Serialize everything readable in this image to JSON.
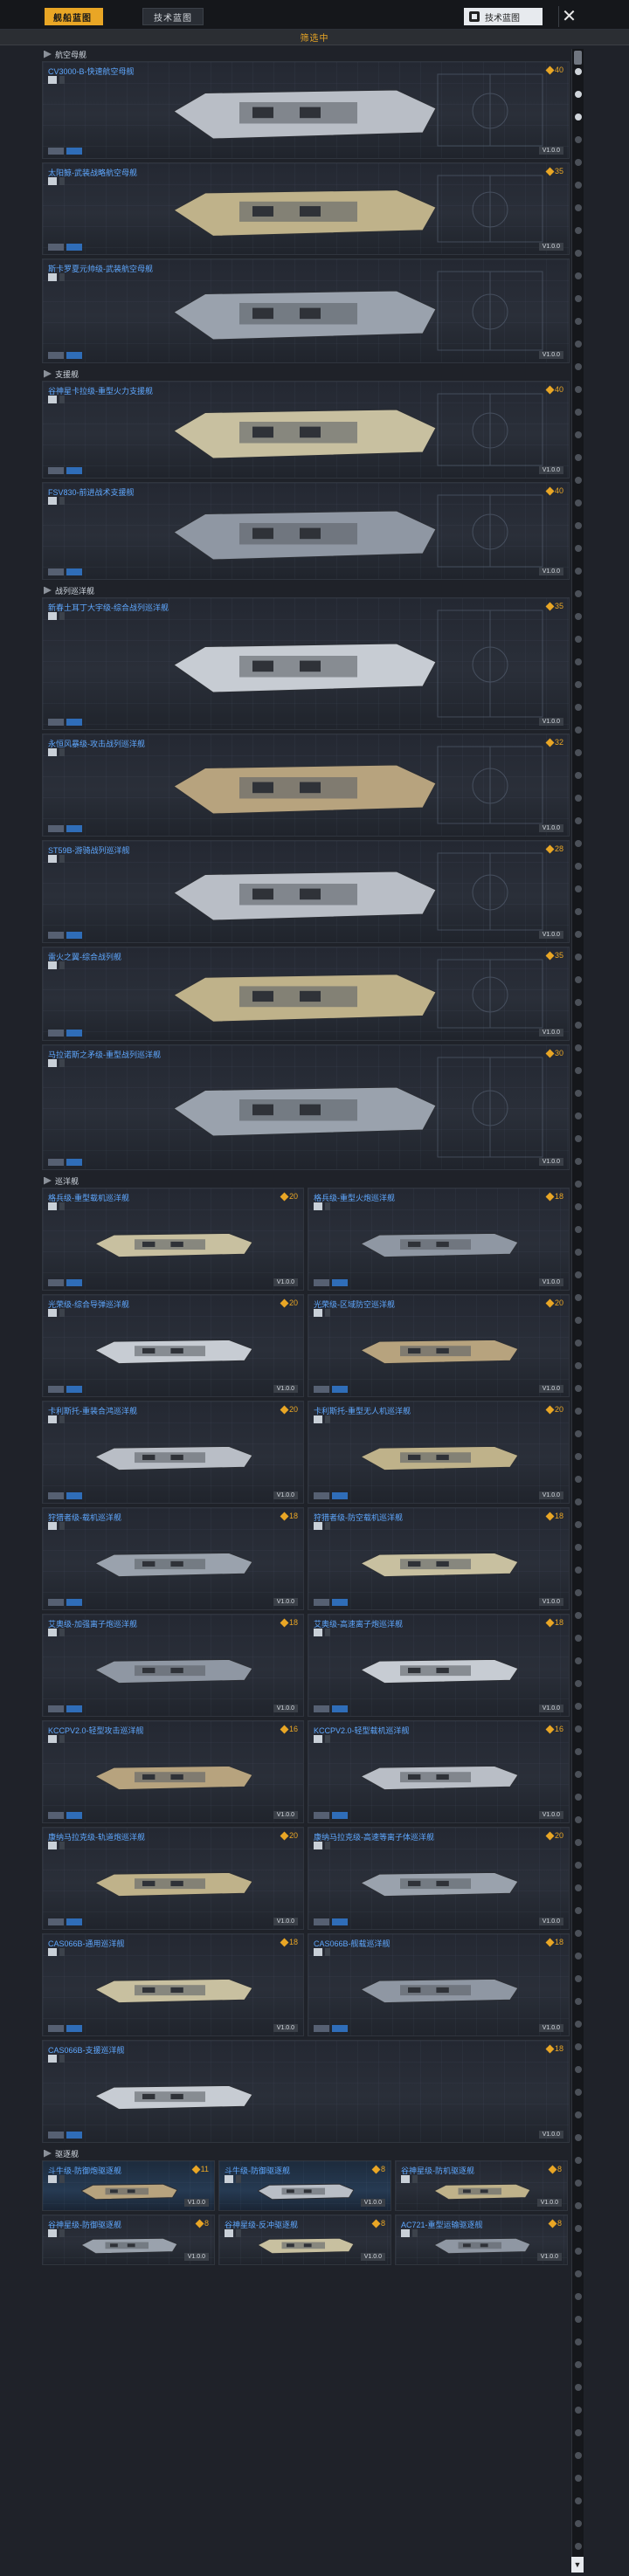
{
  "topbar": {
    "tab_active": "舰船蓝图",
    "tab_inactive": "技术蓝图",
    "tech_button": "技术蓝图",
    "close": "✕"
  },
  "statusbar": {
    "text": "筛选中"
  },
  "categories": {
    "carrier": "航空母舰",
    "support": "支援舰",
    "battlecruiser": "战列巡洋舰",
    "cruiser": "巡洋舰",
    "destroyer": "驱逐舰"
  },
  "ships": {
    "c1": {
      "name": "CV3000-B-快速航空母舰",
      "cost": "40",
      "ver": "V1.0.0"
    },
    "c2": {
      "name": "太阳鲸-武装战略航空母舰",
      "cost": "35",
      "ver": "V1.0.0"
    },
    "c3": {
      "name": "斯卡罗夏元帅级-武装航空母舰",
      "cost": "",
      "ver": "V1.0.0"
    },
    "s1": {
      "name": "谷神星卡拉级-重型火力支援舰",
      "cost": "40",
      "ver": "V1.0.0"
    },
    "s2": {
      "name": "FSV830-前进战术支援舰",
      "cost": "40",
      "ver": "V1.0.0"
    },
    "b1": {
      "name": "新春土耳丁大宇级-综合战列巡洋舰",
      "cost": "35",
      "ver": "V1.0.0"
    },
    "b2": {
      "name": "永恒风暴级-攻击战列巡洋舰",
      "cost": "32",
      "ver": "V1.0.0"
    },
    "b3": {
      "name": "ST59B-游骑战列巡洋舰",
      "cost": "28",
      "ver": "V1.0.0"
    },
    "b4": {
      "name": "雷火之翼-综合战列舰",
      "cost": "35",
      "ver": "V1.0.0"
    },
    "b5": {
      "name": "马拉诺斯之矛级-重型战列巡洋舰",
      "cost": "30",
      "ver": "V1.0.0"
    },
    "cr1": {
      "name": "格兵级-重型载机巡洋舰",
      "cost": "20",
      "ver": "V1.0.0"
    },
    "cr2": {
      "name": "格兵级-重型火炮巡洋舰",
      "cost": "18",
      "ver": "V1.0.0"
    },
    "cr3": {
      "name": "光荣级-综合导弹巡洋舰",
      "cost": "20",
      "ver": "V1.0.0"
    },
    "cr4": {
      "name": "光荣级-区域防空巡洋舰",
      "cost": "20",
      "ver": "V1.0.0"
    },
    "cr5": {
      "name": "卡利斯托-重装合鸿巡洋舰",
      "cost": "20",
      "ver": "V1.0.0"
    },
    "cr6": {
      "name": "卡利斯托-重型无人机巡洋舰",
      "cost": "20",
      "ver": "V1.0.0"
    },
    "cr7": {
      "name": "狩猎者级-载机巡洋舰",
      "cost": "18",
      "ver": "V1.0.0"
    },
    "cr8": {
      "name": "狩猎者级-防空载机巡洋舰",
      "cost": "18",
      "ver": "V1.0.0"
    },
    "cr9": {
      "name": "艾奥级-加强离子炮巡洋舰",
      "cost": "18",
      "ver": "V1.0.0"
    },
    "cr10": {
      "name": "艾奥级-高速离子炮巡洋舰",
      "cost": "18",
      "ver": "V1.0.0"
    },
    "cr11": {
      "name": "KCCPV2.0-轻型攻击巡洋舰",
      "cost": "16",
      "ver": "V1.0.0"
    },
    "cr12": {
      "name": "KCCPV2.0-轻型载机巡洋舰",
      "cost": "16",
      "ver": "V1.0.0"
    },
    "cr13": {
      "name": "康纳马拉克级-轨道炮巡洋舰",
      "cost": "20",
      "ver": "V1.0.0"
    },
    "cr14": {
      "name": "康纳马拉克级-高速等离子体巡洋舰",
      "cost": "20",
      "ver": "V1.0.0"
    },
    "cr15": {
      "name": "CAS066B-通用巡洋舰",
      "cost": "18",
      "ver": "V1.0.0"
    },
    "cr16": {
      "name": "CAS066B-舰载巡洋舰",
      "cost": "18",
      "ver": "V1.0.0"
    },
    "cr17": {
      "name": "CAS066B-支援巡洋舰",
      "cost": "18",
      "ver": "V1.0.0"
    },
    "d1": {
      "name": "斗牛级-防御炮驱逐舰",
      "cost": "11",
      "ver": "V1.0.0"
    },
    "d2": {
      "name": "斗牛级-防御驱逐舰",
      "cost": "8",
      "ver": "V1.0.0"
    },
    "d3": {
      "name": "谷神星级-防机驱逐舰",
      "cost": "8",
      "ver": "V1.0.0"
    },
    "d4": {
      "name": "谷神星级-防御驱逐舰",
      "cost": "8",
      "ver": "V1.0.0"
    },
    "d5": {
      "name": "谷神星级-反冲驱逐舰",
      "cost": "8",
      "ver": "V1.0.0"
    },
    "d6": {
      "name": "AC721-重型运输驱逐舰",
      "cost": "8",
      "ver": "V1.0.0"
    }
  },
  "rail": {
    "bottom": "▼"
  },
  "colors": {
    "accent": "#e9a625",
    "name": "#5fa8ff",
    "bg": "#1f2229"
  }
}
